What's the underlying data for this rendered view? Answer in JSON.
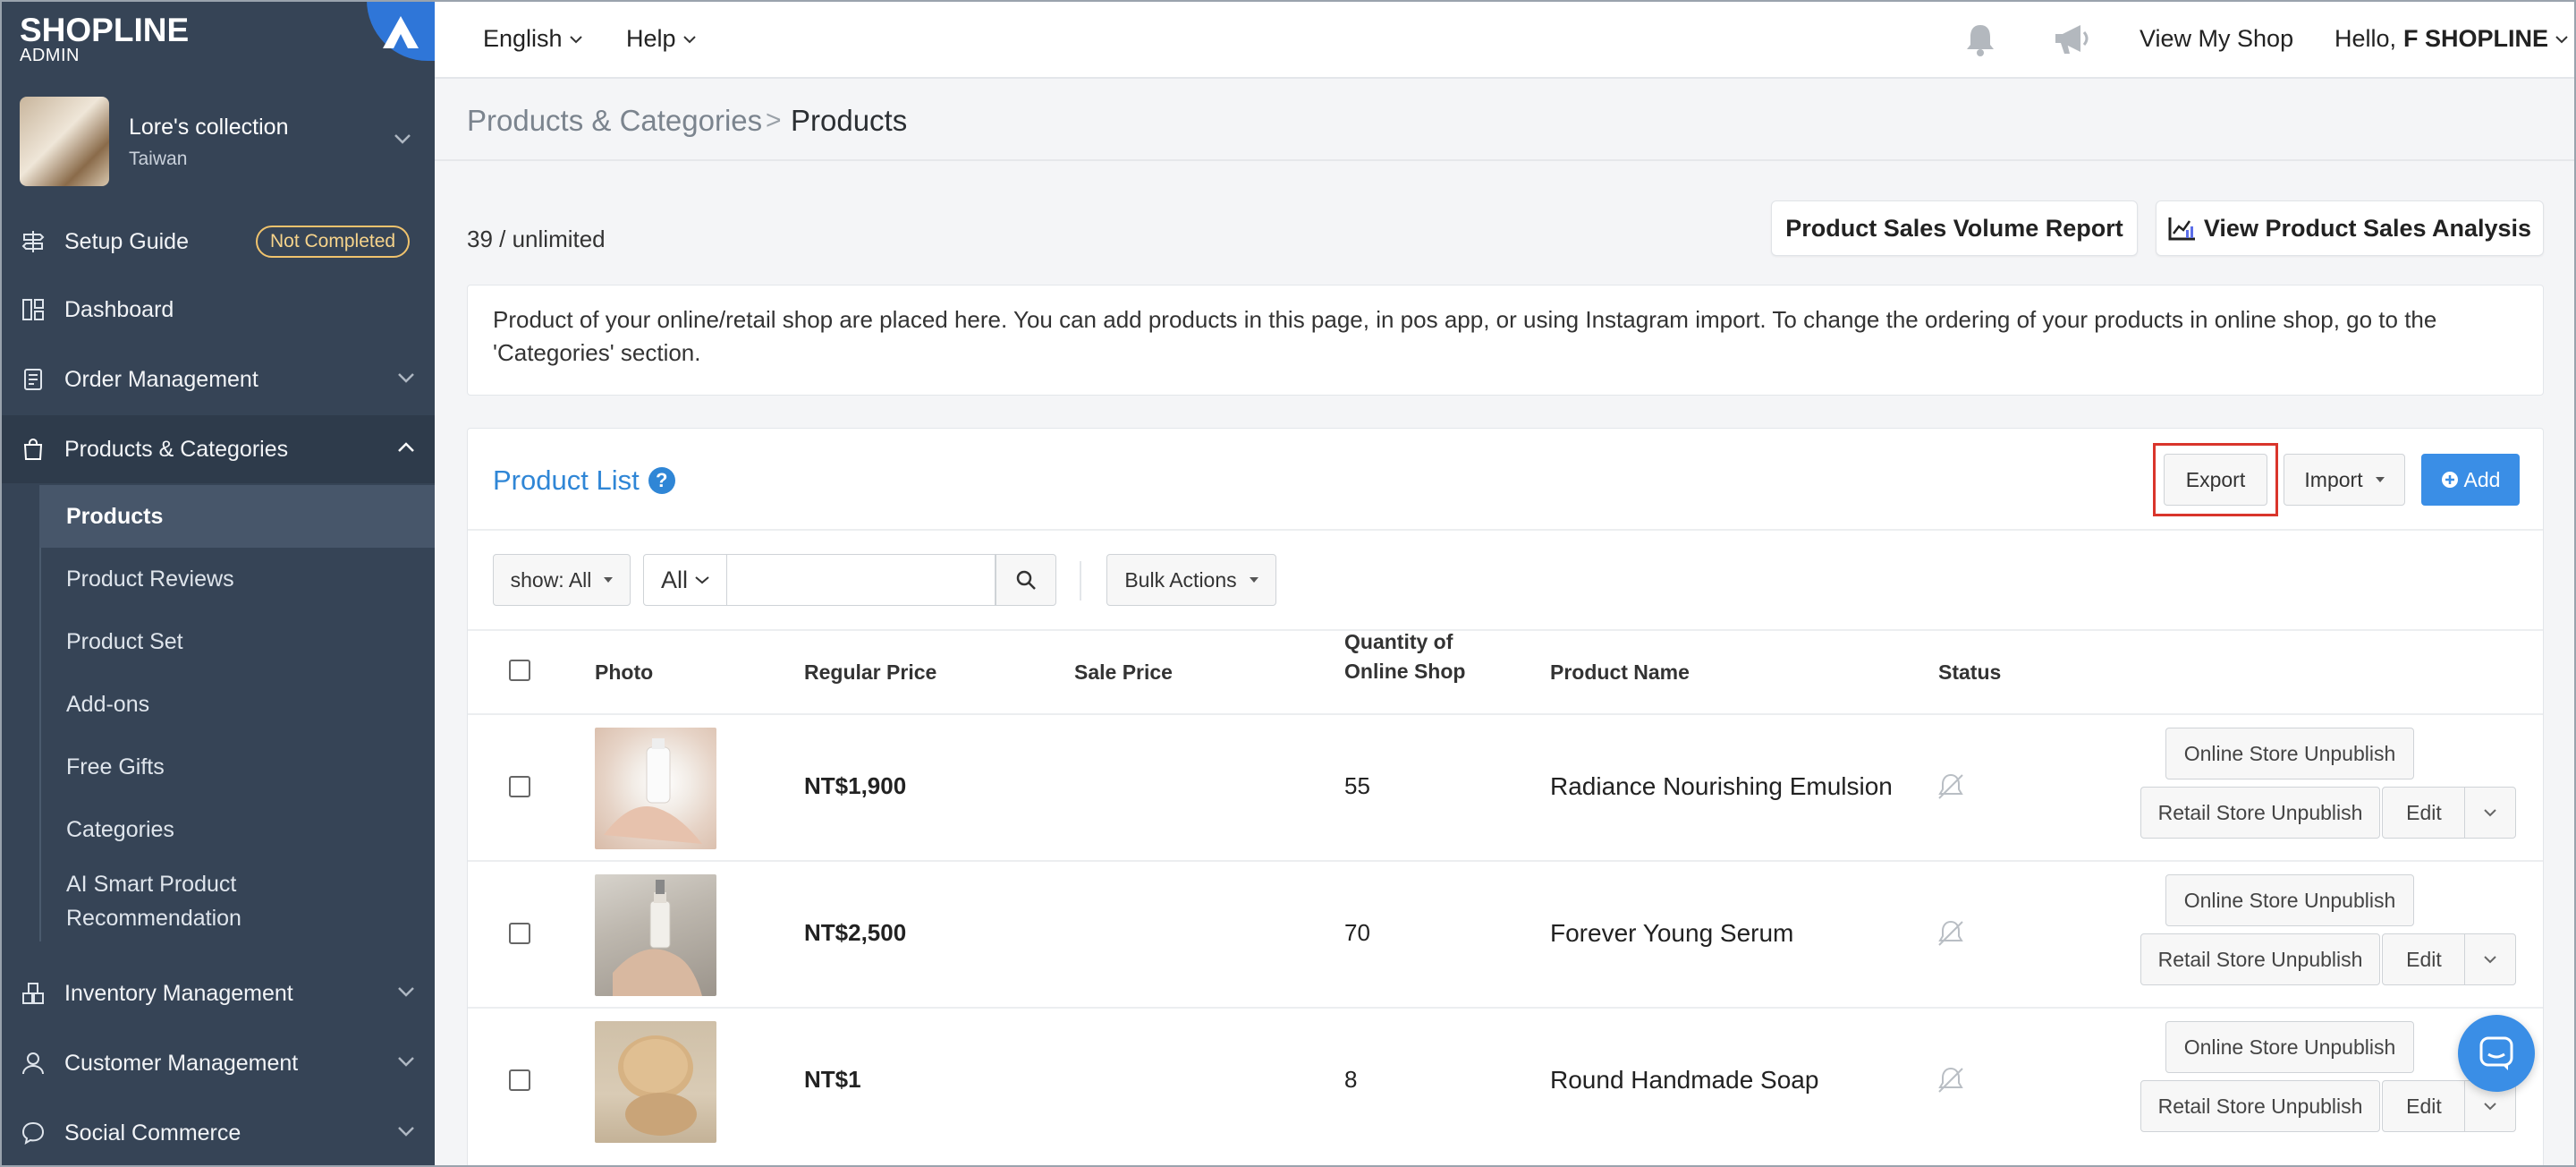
{
  "brand": {
    "logo_line1": "SHOPLINE",
    "logo_line2": "ADMIN"
  },
  "shop": {
    "name": "Lore's collection",
    "location": "Taiwan"
  },
  "sidebar": {
    "setup_guide": "Setup Guide",
    "setup_badge": "Not Completed",
    "dashboard": "Dashboard",
    "order_management": "Order Management",
    "products_categories": "Products & Categories",
    "sub": [
      "Products",
      "Product Reviews",
      "Product Set",
      "Add-ons",
      "Free Gifts",
      "Categories",
      "AI Smart Product Recommendation"
    ],
    "inventory_management": "Inventory Management",
    "customer_management": "Customer Management",
    "social_commerce": "Social Commerce"
  },
  "topbar": {
    "language": "English",
    "help": "Help",
    "view_shop": "View My Shop",
    "hello": "Hello,",
    "user": "F SHOPLINE"
  },
  "breadcrumb": {
    "parent": "Products & Categories",
    "separator": ">",
    "current": "Products"
  },
  "count_text": "39 / unlimited",
  "report_button": "Product Sales Volume Report",
  "analysis_button": "View Product Sales Analysis",
  "info_text": "Product of your online/retail shop are placed here. You can add products in this page, in pos app, or using Instagram import. To change the ordering of your products in online shop, go to the 'Categories' section.",
  "panel": {
    "title": "Product List",
    "help_icon": "?",
    "export": "Export",
    "import": "Import",
    "add": "Add",
    "show_filter": "show: All",
    "all_select": "All",
    "search_placeholder": "",
    "bulk_actions": "Bulk Actions"
  },
  "table": {
    "headers": {
      "photo": "Photo",
      "regular_price": "Regular Price",
      "sale_price": "Sale Price",
      "qty_line1": "Quantity of",
      "qty_line2": "Online Shop",
      "product_name": "Product Name",
      "status": "Status"
    },
    "rows": [
      {
        "price": "NT$1,900",
        "sale": "",
        "qty": "55",
        "name": "Radiance Nourishing Emulsion"
      },
      {
        "price": "NT$2,500",
        "sale": "",
        "qty": "70",
        "name": "Forever Young Serum"
      },
      {
        "price": "NT$1",
        "sale": "",
        "qty": "8",
        "name": "Round Handmade Soap"
      }
    ],
    "actions": {
      "online_unpublish": "Online Store Unpublish",
      "retail_unpublish": "Retail Store Unpublish",
      "edit": "Edit"
    }
  },
  "colors": {
    "sidebar_bg": "#364456",
    "accent_blue": "#2f86d6",
    "add_button": "#3a8ee6",
    "highlight_red": "#d9352b",
    "badge_yellow": "#f0c36d"
  }
}
